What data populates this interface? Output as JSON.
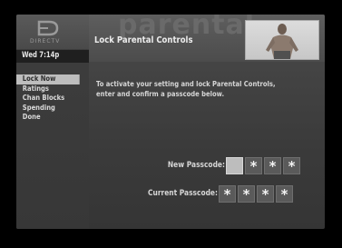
{
  "brand": {
    "logo_text": "DIRECTV"
  },
  "clock": "Wed 7:14p",
  "header": {
    "watermark": "parental",
    "title": "Lock Parental Controls"
  },
  "menu": {
    "items": [
      {
        "label": "Lock Now",
        "selected": true
      },
      {
        "label": "Ratings"
      },
      {
        "label": "Chan Blocks"
      },
      {
        "label": "Spending"
      },
      {
        "label": "Done"
      }
    ]
  },
  "instructions": "To activate your setting and lock Parental Controls, enter and confirm a passcode below.",
  "passcode": {
    "new_label": "New Passcode:",
    "current_label": "Current Passcode:",
    "new_digits": [
      "",
      "*",
      "*",
      "*"
    ],
    "current_digits": [
      "*",
      "*",
      "*",
      "*"
    ]
  }
}
